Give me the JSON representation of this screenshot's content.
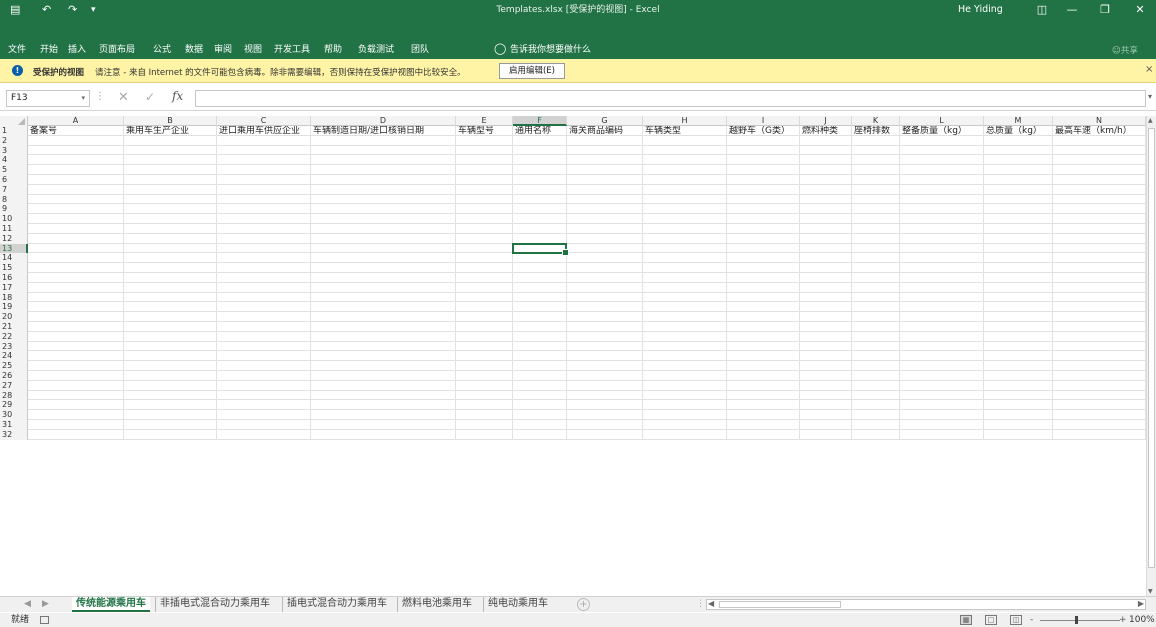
{
  "titlebar": {
    "title": "Templates.xlsx [受保护的视图] - Excel",
    "user": "He Yiding",
    "save_icon": "save-icon",
    "undo_icon": "undo-icon",
    "redo_icon": "redo-icon"
  },
  "ribbon": {
    "tabs": [
      "文件",
      "开始",
      "插入",
      "页面布局",
      "公式",
      "数据",
      "审阅",
      "视图",
      "开发工具",
      "帮助",
      "负载测试",
      "团队"
    ],
    "tell_me": "告诉我你想要做什么",
    "share": "共享"
  },
  "protected_view": {
    "title": "受保护的视图",
    "message": "请注意 - 来自 Internet 的文件可能包含病毒。除非需要编辑，否则保持在受保护视图中比较安全。",
    "enable_button": "启用编辑(E)",
    "close": "×"
  },
  "formula_bar": {
    "name_box": "F13",
    "fx": "fx",
    "formula": ""
  },
  "grid": {
    "columns": [
      "A",
      "B",
      "C",
      "D",
      "E",
      "F",
      "G",
      "H",
      "I",
      "J",
      "K",
      "L",
      "M",
      "N"
    ],
    "selected_column": "F",
    "selected_row": 13,
    "row_count": 32,
    "header_row": [
      "备案号",
      "乘用车生产企业",
      "进口乘用车供应企业",
      "车辆制造日期/进口核销日期",
      "车辆型号",
      "通用名称",
      "海关商品编码",
      "车辆类型",
      "越野车（G类）",
      "燃料种类",
      "座椅排数",
      "整备质量（kg）",
      "总质量（kg）",
      "最高车速（km/h）"
    ]
  },
  "sheets": [
    "传统能源乘用车",
    "非插电式混合动力乘用车",
    "插电式混合动力乘用车",
    "燃料电池乘用车",
    "纯电动乘用车"
  ],
  "active_sheet": 0,
  "status": {
    "ready": "就绪",
    "zoom": "100%",
    "minus": "-",
    "plus": "+"
  },
  "colors": {
    "accent": "#217346",
    "infobar": "#fff4a6"
  }
}
